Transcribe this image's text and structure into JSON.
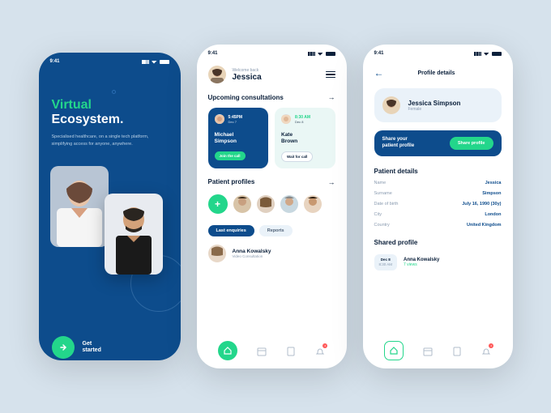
{
  "status_time": "9:41",
  "screen1": {
    "title1": "Virtual",
    "title2": "Ecosystem.",
    "subtitle": "Specialised healthcare, on a single tech platform, simplifying access for anyone, anywhere.",
    "cta": "Get\nstarted"
  },
  "screen2": {
    "welcome": "Welcome back",
    "username": "Jessica",
    "sect1": "Upcoming consultations",
    "consult": [
      {
        "time": "5:45PM",
        "date": "Dec 7",
        "name": "Michael\nSimpson",
        "btn": "Join the call"
      },
      {
        "time": "8:30 AM",
        "date": "Dec 8",
        "name": "Kate\nBrown",
        "btn": "Wait for call"
      }
    ],
    "sect2": "Patient profiles",
    "tabs": [
      "Last enquiries",
      "Reports"
    ],
    "enquiry": {
      "name": "Anna Kowalsky",
      "sub": "Video Consultation"
    },
    "badge": "2"
  },
  "screen3": {
    "title": "Profile details",
    "profile": {
      "name": "Jessica Simpson",
      "gender": "Female"
    },
    "share": {
      "text": "Share your\npatient profile",
      "btn": "Share profile"
    },
    "details_title": "Patient details",
    "details": [
      {
        "label": "Name",
        "value": "Jessica"
      },
      {
        "label": "Surname",
        "value": "Simpson"
      },
      {
        "label": "Date of birth",
        "value": "July 16, 1990 (30y)"
      },
      {
        "label": "City",
        "value": "London"
      },
      {
        "label": "Country",
        "value": "United Kingdom"
      }
    ],
    "shared_title": "Shared profile",
    "shared": {
      "date1": "Dec 8",
      "date2": "8:30 AM",
      "name": "Anna Kowalsky",
      "views": "7 views"
    },
    "badge": "2"
  }
}
